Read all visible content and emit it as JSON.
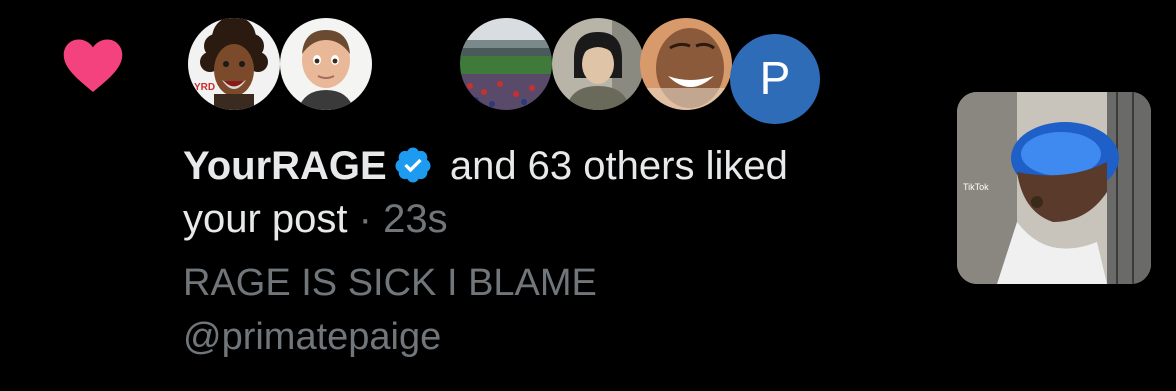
{
  "notification": {
    "type": "like",
    "user_display_name": "YourRAGE",
    "verified": true,
    "action_text": "and 63 others liked",
    "action_text_cont": "your post",
    "separator": "·",
    "timestamp": "23s",
    "post_preview_line1": "RAGE IS SICK I BLAME",
    "post_preview_line2": "@primatepaige",
    "avatars": [
      {
        "name": "avatar-cartoon-dreadlocks"
      },
      {
        "name": "avatar-3d-character"
      },
      {
        "name": "avatar-baseball-stadium"
      },
      {
        "name": "avatar-person-photo"
      },
      {
        "name": "avatar-laughing-face"
      },
      {
        "name": "avatar-letter",
        "letter": "P"
      }
    ],
    "thumbnail_overlay_text": "TikTok",
    "colors": {
      "background": "#000000",
      "heart": "#f4427f",
      "primary_text": "#e7e9ea",
      "secondary_text": "#71767b",
      "verified_blue": "#1d9bf0",
      "letter_avatar": "#2f6cb8"
    }
  }
}
